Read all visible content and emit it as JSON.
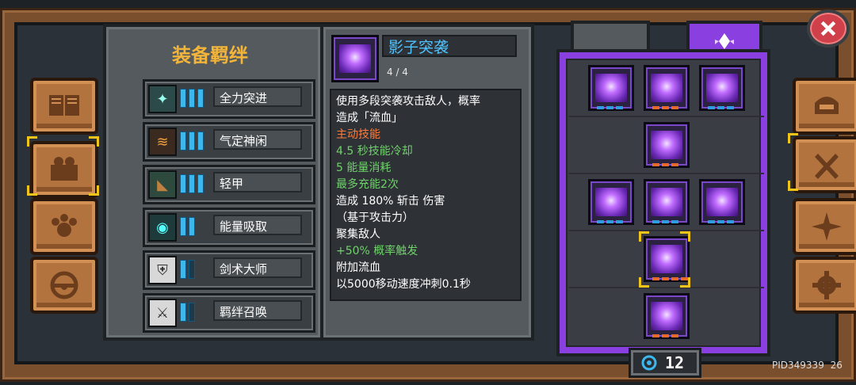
{
  "header": {
    "title": "装备羁绊"
  },
  "bonds": [
    {
      "label": "全力突进",
      "level": 3,
      "icon": "dash-icon"
    },
    {
      "label": "气定神闲",
      "level": 3,
      "icon": "calm-icon"
    },
    {
      "label": "轻甲",
      "level": 3,
      "icon": "light-armor-icon"
    },
    {
      "label": "能量吸取",
      "level": 2,
      "icon": "energy-drain-icon"
    },
    {
      "label": "剑术大师",
      "level": 1,
      "icon": "sword-master-icon"
    },
    {
      "label": "羁绊召唤",
      "level": 1,
      "icon": "bond-summon-icon"
    }
  ],
  "skill_detail": {
    "name": "影子突袭",
    "progress": "4 / 4",
    "lines": [
      {
        "text": "使用多段突袭攻击敌人，概率",
        "color": "#ffffff"
      },
      {
        "text": "造成「流血」",
        "color": "#ffffff"
      },
      {
        "text": "主动技能",
        "color": "#ff7a3a"
      },
      {
        "text": "4.5 秒技能冷却",
        "color": "#6fd26a"
      },
      {
        "text": "5 能量消耗",
        "color": "#6fd26a"
      },
      {
        "text": "最多充能2次",
        "color": "#6fd26a"
      },
      {
        "text": "造成 180% 斩击 伤害",
        "color": "#ffffff"
      },
      {
        "text": "（基于攻击力）",
        "color": "#ffffff"
      },
      {
        "text": "聚集敌人",
        "color": "#ffffff"
      },
      {
        "text": "+50% 概率触发",
        "color": "#6fd26a"
      },
      {
        "text": "附加流血",
        "color": "#ffffff"
      },
      {
        "text": "以5000移动速度冲刺0.1秒",
        "color": "#ffffff"
      }
    ]
  },
  "currency": {
    "value": "12",
    "icon": "swirl-icon"
  },
  "footer": {
    "pid": "PID349339",
    "num": "26"
  },
  "colors": {
    "accent_purple": "#8a3fe0",
    "selection": "#f0c419",
    "bar_blue": "#3db8ef"
  }
}
